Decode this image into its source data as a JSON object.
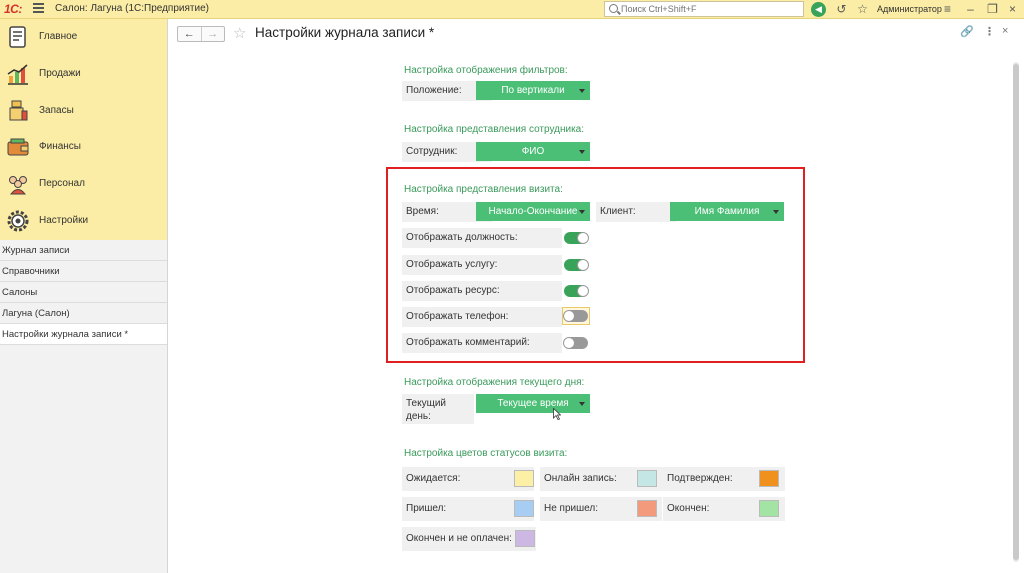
{
  "window": {
    "app_title": "Салон: Лагуна  (1С:Предприятие)",
    "logo_text": "1С:",
    "search_placeholder": "Поиск Ctrl+Shift+F",
    "user": "Администратор"
  },
  "sidebar": {
    "sections": [
      {
        "label": "Главное",
        "icon": "home-ledger-icon"
      },
      {
        "label": "Продажи",
        "icon": "sales-chart-icon"
      },
      {
        "label": "Запасы",
        "icon": "stock-icon"
      },
      {
        "label": "Финансы",
        "icon": "wallet-icon"
      },
      {
        "label": "Персонал",
        "icon": "people-icon"
      },
      {
        "label": "Настройки",
        "icon": "gear-icon"
      }
    ],
    "open_items": [
      {
        "label": "Журнал записи"
      },
      {
        "label": "Справочники"
      },
      {
        "label": "Салоны"
      },
      {
        "label": "Лагуна (Салон)"
      },
      {
        "label": "Настройки журнала записи *"
      }
    ]
  },
  "page": {
    "title": "Настройки журнала записи *"
  },
  "filters": {
    "title": "Настройка отображения фильтров:",
    "position_label": "Положение:",
    "position_value": "По вертикали"
  },
  "employee": {
    "title": "Настройка представления сотрудника:",
    "label": "Сотрудник:",
    "value": "ФИО"
  },
  "visit": {
    "title": "Настройка представления визита:",
    "time_label": "Время:",
    "time_value": "Начало-Окончание",
    "client_label": "Клиент:",
    "client_value": "Имя Фамилия",
    "toggles": [
      {
        "label": "Отображать должность:",
        "on": true
      },
      {
        "label": "Отображать услугу:",
        "on": true
      },
      {
        "label": "Отображать ресурс:",
        "on": true
      },
      {
        "label": "Отображать телефон:",
        "on": false
      },
      {
        "label": "Отображать комментарий:",
        "on": false
      }
    ]
  },
  "current_day": {
    "title": "Настройка отображения текущего дня:",
    "label_line1": "Текущий",
    "label_line2": "день:",
    "value": "Текущее время"
  },
  "status_colors": {
    "title": "Настройка цветов статусов визита:",
    "items": [
      {
        "label": "Ожидается:",
        "color": "#fbf0a6"
      },
      {
        "label": "Онлайн запись:",
        "color": "#c4e6e4"
      },
      {
        "label": "Подтвержден:",
        "color": "#f0911e"
      },
      {
        "label": "Пришел:",
        "color": "#a7cdf2"
      },
      {
        "label": "Не пришел:",
        "color": "#f49a7c"
      },
      {
        "label": "Окончен:",
        "color": "#a3e4a4"
      },
      {
        "label": "Окончен и не оплачен:",
        "color": "#cdb8e4"
      }
    ]
  },
  "colors": {
    "accent_green": "#4cbf77",
    "header_yellow": "#fbeda5",
    "highlight_red": "#e02020"
  }
}
